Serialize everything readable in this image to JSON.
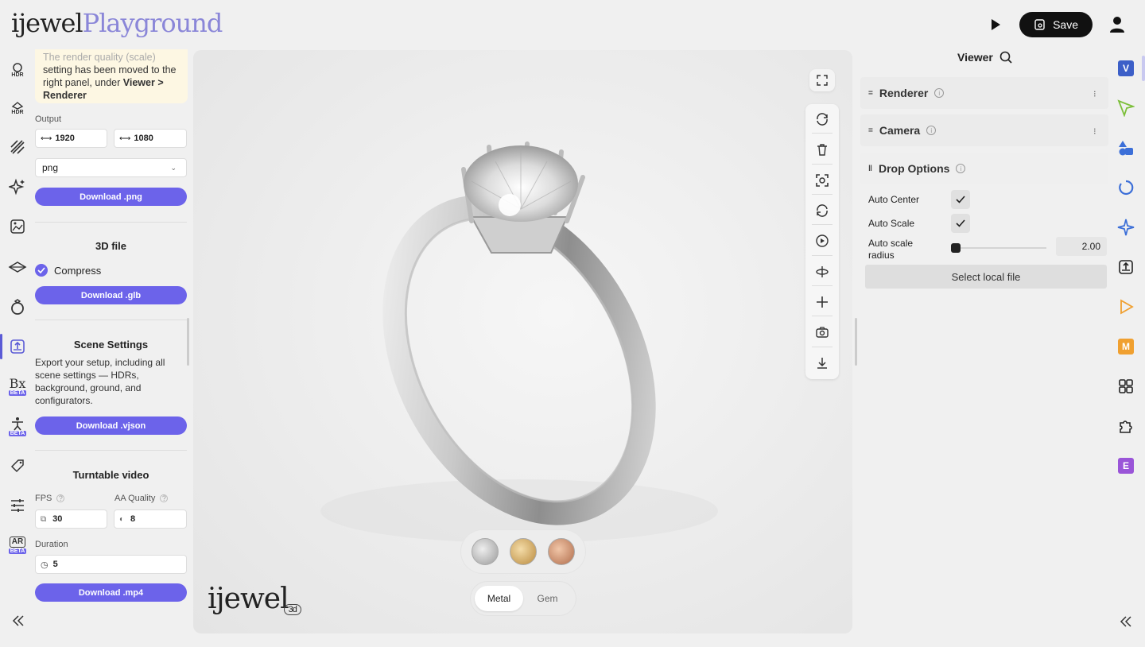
{
  "header": {
    "logo_part1": "ijewel",
    "logo_part2": "Playground",
    "save_label": "Save"
  },
  "left_rail": {
    "items": [
      {
        "icon": "hdr-icon",
        "tag": "HDR"
      },
      {
        "icon": "hdr-ground-icon",
        "tag": "HDR"
      },
      {
        "icon": "pattern-icon",
        "tag": ""
      },
      {
        "icon": "sparkle-icon",
        "tag": ""
      },
      {
        "icon": "scene-image-icon",
        "tag": ""
      },
      {
        "icon": "ground-plane-icon",
        "tag": ""
      },
      {
        "icon": "ring-icon",
        "tag": ""
      },
      {
        "icon": "export-icon",
        "tag": ""
      },
      {
        "icon": "bx-icon",
        "tag": "BETA"
      },
      {
        "icon": "figure-icon",
        "tag": "BETA"
      },
      {
        "icon": "tag-icon",
        "tag": ""
      },
      {
        "icon": "sliders-icon",
        "tag": ""
      },
      {
        "icon": "ar-icon",
        "tag": "BETA"
      }
    ]
  },
  "left_panel": {
    "note_faded": "The render quality (scale)",
    "note_text": "setting has been moved to the right panel, under ",
    "note_bold": "Viewer > Renderer",
    "output_label": "Output",
    "width_value": "1920",
    "height_value": "1080",
    "format_value": "png",
    "download_png": "Download .png",
    "file3d_title": "3D file",
    "compress_label": "Compress",
    "download_glb": "Download .glb",
    "scene_title": "Scene Settings",
    "scene_desc": "Export your setup, including all scene settings — HDRs, background, ground, and configurators.",
    "download_vjson": "Download .vjson",
    "turntable_title": "Turntable video",
    "fps_label": "FPS",
    "fps_value": "30",
    "aa_label": "AA Quality",
    "aa_value": "8",
    "duration_label": "Duration",
    "duration_value": "5",
    "download_mp4": "Download .mp4"
  },
  "viewport": {
    "seg_metal": "Metal",
    "seg_gem": "Gem",
    "logo": "ijewel",
    "logo_badge": "3d",
    "swatch_colors": [
      "#b9b9b9",
      "#d2a866",
      "#c98a6a"
    ]
  },
  "right_panel": {
    "title": "Viewer",
    "renderer": "Renderer",
    "camera": "Camera",
    "drop_options": "Drop Options",
    "auto_center": "Auto Center",
    "auto_scale": "Auto Scale",
    "auto_scale_radius": "Auto scale radius",
    "radius_value": "2.00",
    "radius_fraction": 0.0,
    "select_file": "Select local file"
  },
  "right_rail": {
    "badge_v": "V",
    "badge_m": "M",
    "badge_e": "E"
  },
  "colors": {
    "accent": "#6c63ea",
    "note_bg": "#fdf7e3"
  }
}
